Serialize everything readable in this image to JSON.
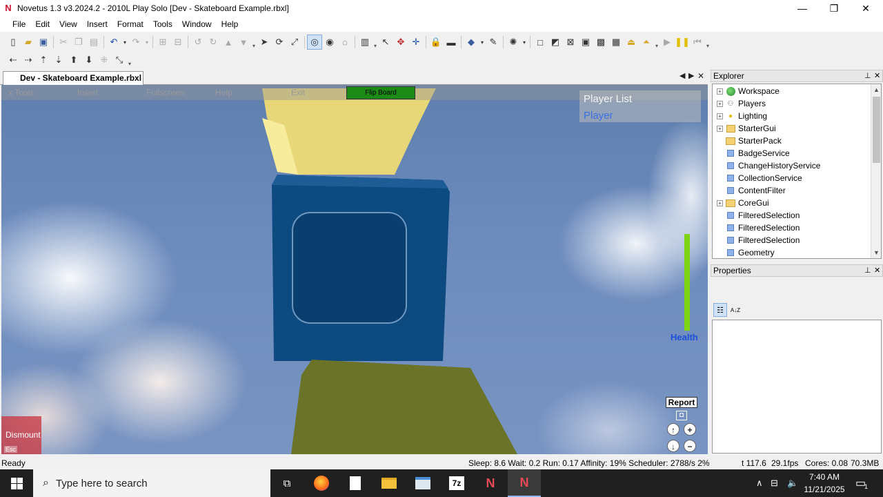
{
  "window": {
    "title": "Novetus 1.3 v3.2024.2 - 2010L Play Solo [Dev - Skateboard Example.rbxl]",
    "logo": "N",
    "minimize": "—",
    "maximize": "❐",
    "close": "✕"
  },
  "menu": [
    "File",
    "Edit",
    "View",
    "Insert",
    "Format",
    "Tools",
    "Window",
    "Help"
  ],
  "document_tab": {
    "label": "Dev - Skateboard Example.rbxl"
  },
  "game": {
    "menu": [
      "x Tools",
      "Insert",
      "Fullscreen",
      "Help",
      "Exit"
    ],
    "flip_board": "Flip Board",
    "player_list": {
      "title": "Player List",
      "player": "Player"
    },
    "health": {
      "label": "Health",
      "level_fraction": 1.0
    },
    "report": "Report",
    "dismount": {
      "label": "Dismount",
      "hint": "Esc"
    }
  },
  "explorer": {
    "title": "Explorer",
    "items": [
      {
        "label": "Workspace",
        "icon": "globe-icon",
        "expandable": true
      },
      {
        "label": "Players",
        "icon": "players-icon",
        "expandable": true
      },
      {
        "label": "Lighting",
        "icon": "lighting-icon",
        "expandable": true
      },
      {
        "label": "StarterGui",
        "icon": "startergui-icon",
        "expandable": true
      },
      {
        "label": "StarterPack",
        "icon": "folder-icon",
        "expandable": false
      },
      {
        "label": "BadgeService",
        "icon": "service-icon",
        "expandable": false
      },
      {
        "label": "ChangeHistoryService",
        "icon": "service-icon",
        "expandable": false
      },
      {
        "label": "CollectionService",
        "icon": "service-icon",
        "expandable": false
      },
      {
        "label": "ContentFilter",
        "icon": "service-icon",
        "expandable": false
      },
      {
        "label": "CoreGui",
        "icon": "folder-icon",
        "expandable": true
      },
      {
        "label": "FilteredSelection",
        "icon": "service-icon",
        "expandable": false
      },
      {
        "label": "FilteredSelection",
        "icon": "service-icon",
        "expandable": false
      },
      {
        "label": "FilteredSelection",
        "icon": "service-icon",
        "expandable": false
      },
      {
        "label": "Geometry",
        "icon": "service-icon",
        "expandable": false
      }
    ]
  },
  "properties": {
    "title": "Properties",
    "sort_az": "A↓Z"
  },
  "status": {
    "left": "Ready",
    "stats": "Sleep: 8.6 Wait: 0.2 Run: 0.17 Affinity: 19% Scheduler: 2788/s 2%",
    "time": "t 117.6",
    "fps": "29.1fps",
    "cores": "Cores: 0.08",
    "memory": "70.3MB"
  },
  "taskbar": {
    "search_placeholder": "Type here to search",
    "apps": [
      "task-view-icon",
      "firefox-icon",
      "file-icon",
      "file-explorer-icon",
      "notepad-icon",
      "7zip-icon",
      "novetus-icon",
      "novetus-icon"
    ],
    "app_7z": "7z",
    "time": "7:40 AM",
    "date": "11/21/2025",
    "notifications": "1"
  },
  "colors": {
    "viewport_sky": "#6c8bbd",
    "flip_board": "#1d8a18",
    "player_name": "#3a6fe0",
    "health": "#7ed314",
    "health_label": "#1e4fd8",
    "dismount": "#c83c46",
    "board_top": "#f1e48a",
    "board_blue": "#0e4f86",
    "board_green": "#6a7328",
    "taskbar": "#202020"
  }
}
